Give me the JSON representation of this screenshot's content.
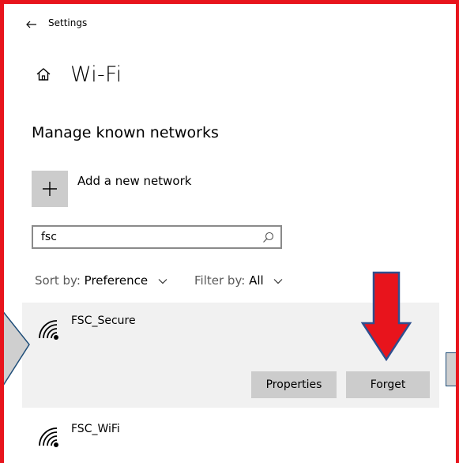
{
  "header": {
    "back_icon": "back-arrow-icon",
    "app_title": "Settings"
  },
  "page": {
    "home_icon": "home-icon",
    "title": "Wi-Fi",
    "section_title": "Manage known networks"
  },
  "add_network": {
    "icon": "plus-icon",
    "label": "Add a new network"
  },
  "search": {
    "value": "fsc",
    "icon": "search-icon"
  },
  "sort": {
    "label": "Sort by:",
    "value": "Preference"
  },
  "filter": {
    "label": "Filter by:",
    "value": "All"
  },
  "networks": [
    {
      "name": "FSC_Secure",
      "icon": "wifi-secure-icon",
      "selected": true
    },
    {
      "name": "FSC_WiFi",
      "icon": "wifi-icon",
      "selected": false
    }
  ],
  "actions": {
    "properties_label": "Properties",
    "forget_label": "Forget"
  },
  "colors": {
    "annotation_red": "#e8141c",
    "annotation_blue": "#2f4f8f",
    "selected_card": "#f1f1f1",
    "button_bg": "#cccccc"
  }
}
